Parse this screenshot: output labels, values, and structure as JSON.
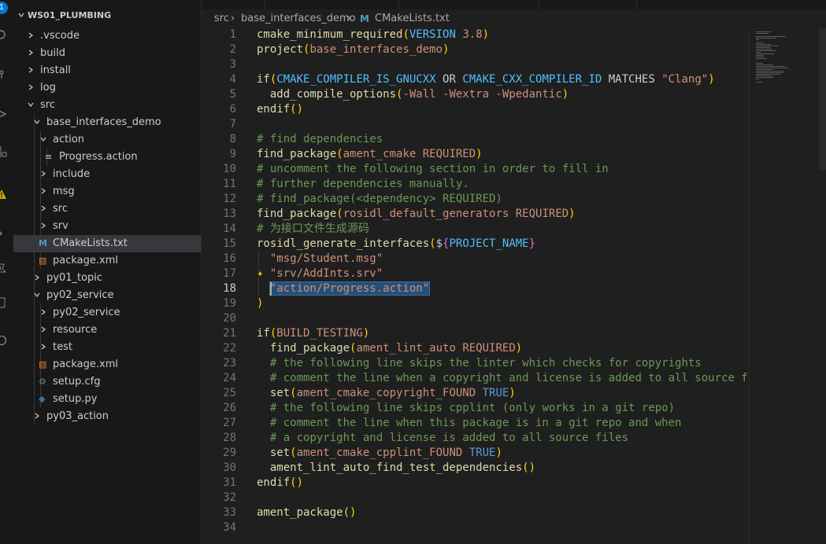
{
  "activity": {
    "badge": "1"
  },
  "explorer": {
    "workspace_title": "WS01_PLUMBING",
    "items": [
      {
        "label": ".vscode",
        "type": "folder"
      },
      {
        "label": "build",
        "type": "folder"
      },
      {
        "label": "install",
        "type": "folder"
      },
      {
        "label": "log",
        "type": "folder"
      },
      {
        "label": "src",
        "type": "folder-open"
      },
      {
        "label": "base_interfaces_demo",
        "type": "folder-open"
      },
      {
        "label": "action",
        "type": "folder-open"
      },
      {
        "label": "Progress.action",
        "type": "file-lines"
      },
      {
        "label": "include",
        "type": "folder"
      },
      {
        "label": "msg",
        "type": "folder"
      },
      {
        "label": "src",
        "type": "folder"
      },
      {
        "label": "srv",
        "type": "folder"
      },
      {
        "label": "CMakeLists.txt",
        "type": "file-cmake"
      },
      {
        "label": "package.xml",
        "type": "file-xml"
      },
      {
        "label": "py01_topic",
        "type": "folder"
      },
      {
        "label": "py02_service",
        "type": "folder-open"
      },
      {
        "label": "py02_service",
        "type": "folder"
      },
      {
        "label": "resource",
        "type": "folder"
      },
      {
        "label": "test",
        "type": "folder"
      },
      {
        "label": "package.xml",
        "type": "file-xml"
      },
      {
        "label": "setup.cfg",
        "type": "file-gear"
      },
      {
        "label": "setup.py",
        "type": "file-python"
      },
      {
        "label": "py03_action",
        "type": "folder"
      }
    ]
  },
  "breadcrumb": {
    "seg1": "src",
    "seg2": "base_interfaces_demo",
    "seg3": "CMakeLists.txt",
    "cmake_icon": "M"
  },
  "editor": {
    "current_line": 18,
    "lines": [
      {
        "n": "1",
        "parts": [
          [
            "fn",
            "cmake_minimum_required"
          ],
          [
            "p",
            "("
          ],
          [
            "var",
            "VERSION"
          ],
          [
            "arg",
            " 3.8"
          ],
          [
            "p",
            ")"
          ]
        ]
      },
      {
        "n": "2",
        "parts": [
          [
            "fn",
            "project"
          ],
          [
            "p",
            "("
          ],
          [
            "arg",
            "base_interfaces_demo"
          ],
          [
            "p",
            ")"
          ]
        ]
      },
      {
        "n": "3",
        "parts": []
      },
      {
        "n": "4",
        "parts": [
          [
            "fn",
            "if"
          ],
          [
            "p",
            "("
          ],
          [
            "var",
            "CMAKE_COMPILER_IS_GNUCXX"
          ],
          [
            "kw",
            " OR "
          ],
          [
            "var",
            "CMAKE_CXX_COMPILER_ID"
          ],
          [
            "kw",
            " MATCHES "
          ],
          [
            "str",
            "\"Clang\""
          ],
          [
            "p",
            ")"
          ]
        ]
      },
      {
        "n": "5",
        "parts": [
          [
            "kw",
            "  "
          ],
          [
            "fn",
            "add_compile_options"
          ],
          [
            "p",
            "("
          ],
          [
            "arg",
            "-Wall -Wextra -Wpedantic"
          ],
          [
            "p",
            ")"
          ]
        ]
      },
      {
        "n": "6",
        "parts": [
          [
            "fn",
            "endif"
          ],
          [
            "p",
            "()"
          ]
        ]
      },
      {
        "n": "7",
        "parts": []
      },
      {
        "n": "8",
        "parts": [
          [
            "cm",
            "# find dependencies"
          ]
        ]
      },
      {
        "n": "9",
        "parts": [
          [
            "fn",
            "find_package"
          ],
          [
            "p",
            "("
          ],
          [
            "arg",
            "ament_cmake REQUIRED"
          ],
          [
            "p",
            ")"
          ]
        ]
      },
      {
        "n": "10",
        "parts": [
          [
            "cm",
            "# uncomment the following section in order to fill in"
          ]
        ]
      },
      {
        "n": "11",
        "parts": [
          [
            "cm",
            "# further dependencies manually."
          ]
        ]
      },
      {
        "n": "12",
        "parts": [
          [
            "cm",
            "# find_package(<dependency> REQUIRED)"
          ]
        ]
      },
      {
        "n": "13",
        "parts": [
          [
            "fn",
            "find_package"
          ],
          [
            "p",
            "("
          ],
          [
            "arg",
            "rosidl_default_generators REQUIRED"
          ],
          [
            "p",
            ")"
          ]
        ]
      },
      {
        "n": "14",
        "parts": [
          [
            "cm",
            "# 为接口文件生成源码"
          ]
        ]
      },
      {
        "n": "15",
        "parts": [
          [
            "fn",
            "rosidl_generate_interfaces"
          ],
          [
            "p",
            "("
          ],
          [
            "kw",
            "$"
          ],
          [
            "mag",
            "{"
          ],
          [
            "var",
            "PROJECT_NAME"
          ],
          [
            "mag",
            "}"
          ]
        ]
      },
      {
        "n": "16",
        "parts": [
          [
            "kw",
            "  "
          ],
          [
            "str",
            "\"msg/Student.msg\""
          ]
        ]
      },
      {
        "n": "17",
        "parts": [
          [
            "kw",
            "  "
          ],
          [
            "str",
            "\"srv/AddInts.srv\""
          ]
        ]
      },
      {
        "n": "18",
        "parts": [
          [
            "kw",
            "  "
          ],
          [
            "strsel",
            "\"action/Progress.action\""
          ]
        ]
      },
      {
        "n": "19",
        "parts": [
          [
            "p",
            ")"
          ]
        ]
      },
      {
        "n": "20",
        "parts": []
      },
      {
        "n": "21",
        "parts": [
          [
            "fn",
            "if"
          ],
          [
            "p",
            "("
          ],
          [
            "arg",
            "BUILD_TESTING"
          ],
          [
            "p",
            ")"
          ]
        ]
      },
      {
        "n": "22",
        "parts": [
          [
            "kw",
            "  "
          ],
          [
            "fn",
            "find_package"
          ],
          [
            "p",
            "("
          ],
          [
            "arg",
            "ament_lint_auto REQUIRED"
          ],
          [
            "p",
            ")"
          ]
        ]
      },
      {
        "n": "23",
        "parts": [
          [
            "kw",
            "  "
          ],
          [
            "cm",
            "# the following line skips the linter which checks for copyrights"
          ]
        ]
      },
      {
        "n": "24",
        "parts": [
          [
            "kw",
            "  "
          ],
          [
            "cm",
            "# comment the line when a copyright and license is added to all source fi"
          ]
        ]
      },
      {
        "n": "25",
        "parts": [
          [
            "kw",
            "  "
          ],
          [
            "fn",
            "set"
          ],
          [
            "p",
            "("
          ],
          [
            "arg",
            "ament_cmake_copyright_FOUND "
          ],
          [
            "bool",
            "TRUE"
          ],
          [
            "p",
            ")"
          ]
        ]
      },
      {
        "n": "26",
        "parts": [
          [
            "kw",
            "  "
          ],
          [
            "cm",
            "# the following line skips cpplint (only works in a git repo)"
          ]
        ]
      },
      {
        "n": "27",
        "parts": [
          [
            "kw",
            "  "
          ],
          [
            "cm",
            "# comment the line when this package is in a git repo and when"
          ]
        ]
      },
      {
        "n": "28",
        "parts": [
          [
            "kw",
            "  "
          ],
          [
            "cm",
            "# a copyright and license is added to all source files"
          ]
        ]
      },
      {
        "n": "29",
        "parts": [
          [
            "kw",
            "  "
          ],
          [
            "fn",
            "set"
          ],
          [
            "p",
            "("
          ],
          [
            "arg",
            "ament_cmake_cpplint_FOUND "
          ],
          [
            "bool",
            "TRUE"
          ],
          [
            "p",
            ")"
          ]
        ]
      },
      {
        "n": "30",
        "parts": [
          [
            "kw",
            "  "
          ],
          [
            "fn",
            "ament_lint_auto_find_test_dependencies"
          ],
          [
            "p",
            "()"
          ]
        ]
      },
      {
        "n": "31",
        "parts": [
          [
            "fn",
            "endif"
          ],
          [
            "p",
            "()"
          ]
        ]
      },
      {
        "n": "32",
        "parts": []
      },
      {
        "n": "33",
        "parts": [
          [
            "fn",
            "ament_package"
          ],
          [
            "p",
            "()"
          ]
        ]
      },
      {
        "n": "34",
        "parts": []
      }
    ]
  },
  "colors": {
    "accent": "#0078d4",
    "selection": "#264f78",
    "sparkle": "#ffcc00"
  }
}
